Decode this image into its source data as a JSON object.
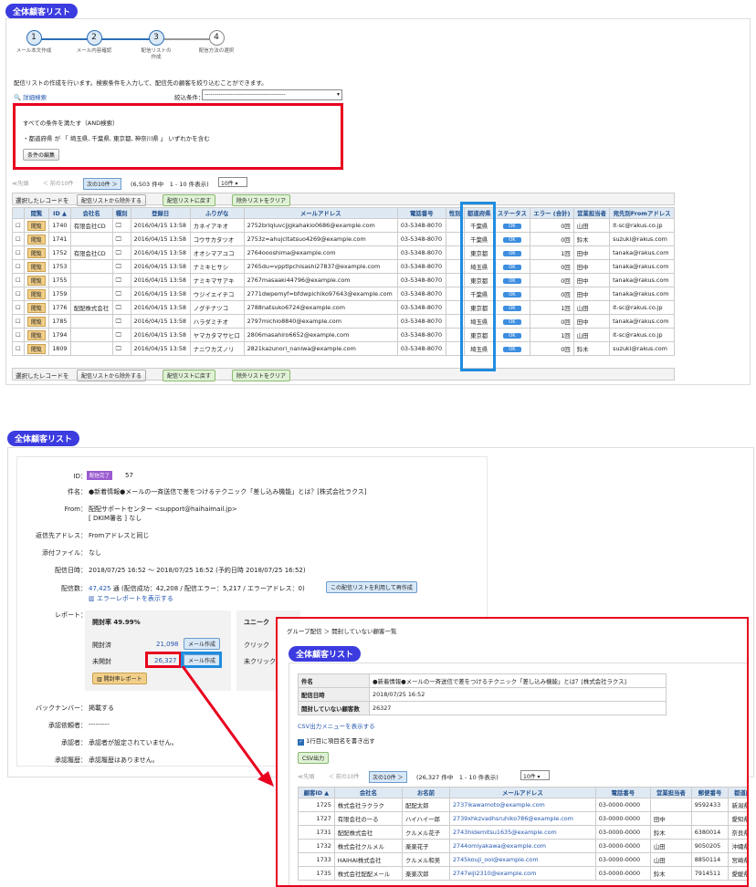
{
  "top": {
    "title": "全体顧客リスト",
    "steps": [
      "1",
      "2",
      "3",
      "4"
    ],
    "step_labels": [
      "メール本文作成",
      "メール内容確認",
      "配信リストの\n作成",
      "配信方法の選択"
    ],
    "desc": "配信リストの作成を行います。検索条件を入力して、配信先の顧客を絞り込むことができます。",
    "detail_search": "詳細検索",
    "filter_label": "絞込条件：",
    "filter_value": "-----------------------------------------",
    "cond_all": "すべての条件を満たす（AND検索）",
    "cond_text": "・都道府県 が 「 埼玉県, 千葉県, 東京都, 神奈川県 」 いずれかを含む",
    "edit_btn": "条件の編集",
    "pager": {
      "first": "≪先頭",
      "prev": "＜ 前の10件",
      "next": "次の10件 ＞",
      "summary": "(6,503 件中　1 - 10 件表示)",
      "per": "10件"
    },
    "selected_label": "選択したレコードを",
    "actions": [
      "配信リストから除外する",
      "配信リストに戻す",
      "除外リストをクリア"
    ],
    "headers": [
      "",
      "閲覧",
      "ID ▲",
      "会社名",
      "種別",
      "登録日",
      "ふりがな",
      "メールアドレス",
      "電話番号",
      "性別",
      "都道府県",
      "ステータス",
      "エラー (合計)",
      "営業担当者",
      "宛先別Fromアドレス"
    ],
    "view_label": "閲覧",
    "rows": [
      [
        "1740",
        "有限会社CD",
        "2016/04/15 13:58",
        "カネイアキオ",
        "2752brlqluvcjjgkahakio0686@example.com",
        "03-5348-8070",
        "千葉県",
        "OK",
        "0回",
        "山田",
        "it-sc@rakus.co.jp"
      ],
      [
        "1741",
        "",
        "2016/04/15 13:58",
        "コウサカタツオ",
        "2753z=ahujcltatsuo4269@example.com",
        "03-5348-8070",
        "千葉県",
        "OK",
        "0回",
        "鈴木",
        "suzuki@rakus.com"
      ],
      [
        "1752",
        "有限会社CD",
        "2016/04/15 13:58",
        "オオシマアユコ",
        "2764oooshima@example.com",
        "03-5348-8070",
        "東京都",
        "OK",
        "1回",
        "田中",
        "tanaka@rakus.com"
      ],
      [
        "1753",
        "",
        "2016/04/15 13:58",
        "ナミキヒサシ",
        "2765du=vpptlpchisashi27837@example.com",
        "03-5348-8070",
        "埼玉県",
        "OK",
        "0回",
        "田中",
        "tanaka@rakus.com"
      ],
      [
        "1755",
        "",
        "2016/04/15 13:58",
        "ナミキマサアキ",
        "2767masaaki44796@example.com",
        "03-5348-8070",
        "東京都",
        "OK",
        "0回",
        "田中",
        "tanaka@rakus.com"
      ],
      [
        "1759",
        "",
        "2016/04/15 13:58",
        "ウジイエイチコ",
        "2771dwpemyf=bfdwpichiko97643@example.com",
        "03-5348-8070",
        "千葉県",
        "OK",
        "0回",
        "田中",
        "tanaka@rakus.com"
      ],
      [
        "1776",
        "配配株式会社",
        "2016/04/15 13:58",
        "ノグチナツコ",
        "2788natsuko6724@example.com",
        "03-5348-8070",
        "東京都",
        "OK",
        "1回",
        "山田",
        "it-sc@rakus.co.jp"
      ],
      [
        "1785",
        "",
        "2016/04/15 13:58",
        "ハラダミチオ",
        "2797michio8840@example.com",
        "03-5348-8070",
        "埼玉県",
        "OK",
        "0回",
        "田中",
        "tanaka@rakus.com"
      ],
      [
        "1794",
        "",
        "2016/04/15 13:58",
        "ヤマカタマサヒロ",
        "2806masahiro6652@example.com",
        "03-5348-8070",
        "東京都",
        "OK",
        "1回",
        "山田",
        "it-sc@rakus.co.jp"
      ],
      [
        "1809",
        "",
        "2016/04/15 13:58",
        "ナニワカズノリ",
        "2821kazunori_naniwa@example.com",
        "03-5348-8070",
        "埼玉県",
        "OK",
        "0回",
        "鈴木",
        "suzuki@rakus.com"
      ]
    ]
  },
  "mid": {
    "title": "全体顧客リスト",
    "id_label": "ID：",
    "status": "配信完了",
    "id": "57",
    "subject_label": "件名：",
    "subject": "●新着情報●メールの一斉送信で差をつけるテクニック「差し込み機能」とは？[株式会社ラクス]",
    "from_label": "From：",
    "from": "配配サポートセンター <support@haihaimail.jp>",
    "dkim": "[ DKIM署名 ] なし",
    "reply_label": "返信先アドレス：",
    "reply": "Fromアドレスと同じ",
    "attach_label": "添付ファイル：",
    "attach": "なし",
    "date_label": "配信日時：",
    "date": "2018/07/25 16:52 ～ 2018/07/25 16:52  (予約日時 2018/07/25 16:52)",
    "count_label": "配信数：",
    "count": "47,425",
    "count_detail": "通 (配信成功：42,208 / 配信エラー：5,217 / エラーアドレス：0)",
    "resend_btn": "この配信リストを利用して再作成",
    "error_report": "エラーレポートを表示する",
    "report_label": "レポート：",
    "open_rate": "開封率 49.99%",
    "opened_label": "開封済",
    "opened": "21,098",
    "unopened_label": "未開封",
    "unopened": "26,327",
    "mail_btn": "メール作成",
    "open_report": "開封率レポート",
    "unique_label": "ユニーク",
    "click_label": "クリック",
    "unclick_label": "未クリック",
    "backnum_label": "バックナンバー：",
    "backnum": "掲載する",
    "approve_req_label": "承認依頼者：",
    "approve_req": "---------",
    "approver_label": "承認者：",
    "approver": "承認者が設定されていません。",
    "history_label": "承認履歴：",
    "history": "承認履歴はありません。"
  },
  "popup": {
    "breadcrumb": "グループ配信 ＞ 開封していない顧客一覧",
    "title": "全体顧客リスト",
    "subject_label": "件名",
    "subject": "●新着情報●メールの一斉送信で差をつけるテクニック「差し込み機能」とは？[株式会社ラクス]",
    "date_label": "配信日時",
    "date": "2018/07/25 16:52",
    "count_label": "開封していない顧客数",
    "count": "26327",
    "csv_menu": "CSV出力メニューを表示する",
    "csv_check": "1行目に項目名を書き出す",
    "csv_btn": "CSV出力",
    "pager": {
      "first": "≪先頭",
      "prev": "＜ 前の10件",
      "next": "次の10件 ＞",
      "summary": "(26,327 件中　1 - 10 件表示)",
      "per": "10件"
    },
    "headers": [
      "顧客ID ▲",
      "会社名",
      "お名前",
      "メールアドレス",
      "電話番号",
      "営業担当者",
      "郵便番号",
      "都道府県"
    ],
    "rows": [
      [
        "1725",
        "株式会社ラクラク",
        "配配太郎",
        "2737ikawamoto@example.com",
        "03-0000-0000",
        "",
        "9592433",
        "新潟県"
      ],
      [
        "1727",
        "有限会社の一る",
        "ハイハイ一郎",
        "2739xhkzvadhsruhiko786@example.com",
        "03-0000-0000",
        "田中",
        "",
        "愛知県"
      ],
      [
        "1731",
        "配配株式会社",
        "クルメル花子",
        "2743hidemitsu1635@example.com",
        "03-0000-0000",
        "鈴木",
        "6380014",
        "奈良県"
      ],
      [
        "1732",
        "株式会社クルメル",
        "楽楽花子",
        "2744omiyakawa@example.com",
        "03-0000-0000",
        "山田",
        "9050205",
        "沖縄県"
      ],
      [
        "1733",
        "HAIHAI株式会社",
        "クルメル和美",
        "2745kouji_ooi@example.com",
        "03-0000-0000",
        "山田",
        "8850114",
        "宮崎県"
      ],
      [
        "1735",
        "株式会社配配メール",
        "楽楽次郎",
        "2747eiji2310@example.com",
        "03-0000-0000",
        "鈴木",
        "7914511",
        "愛媛県"
      ]
    ]
  }
}
